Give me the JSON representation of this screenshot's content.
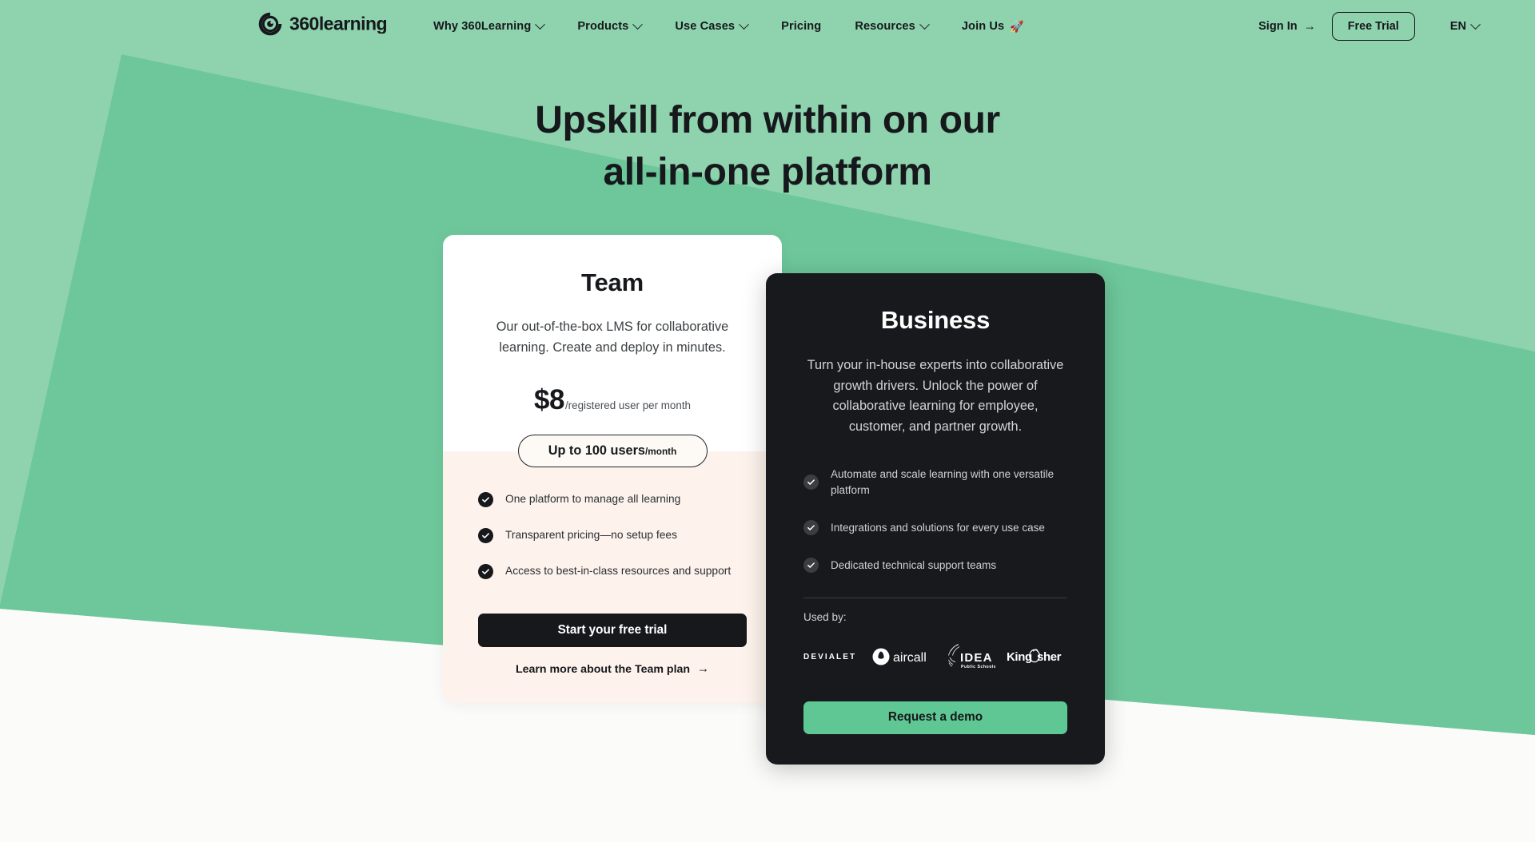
{
  "colors": {
    "bg_green_light": "#8ed3ae",
    "bg_green_dark": "#6ec79b",
    "page_white": "#fbfbfa",
    "ink": "#16181c",
    "card_cream": "#fdf3ec",
    "card_dark": "#18191d",
    "accent_green": "#5ec793"
  },
  "nav": {
    "logo_text": "360learning",
    "links": [
      {
        "label": "Why 360Learning",
        "has_caret": true
      },
      {
        "label": "Products",
        "has_caret": true
      },
      {
        "label": "Use Cases",
        "has_caret": true
      },
      {
        "label": "Pricing",
        "has_caret": false
      },
      {
        "label": "Resources",
        "has_caret": true
      },
      {
        "label": "Join Us",
        "has_caret": false,
        "emoji": "🚀"
      }
    ],
    "sign_in": "Sign In",
    "sign_in_arrow": "→",
    "free_trial": "Free Trial",
    "language": "EN"
  },
  "hero": {
    "line1": "Upskill from within on our",
    "line2": "all-in-one platform"
  },
  "team_plan": {
    "title": "Team",
    "description": "Our out-of-the-box LMS for collaborative learning. Create and deploy in minutes.",
    "price": "$8",
    "price_unit": "/registered user per month",
    "seats_badge_main": "Up to 100 users",
    "seats_badge_sub": "/month",
    "features": [
      "One platform to manage all learning",
      "Transparent pricing—no setup fees",
      "Access to best-in-class resources and support"
    ],
    "cta_primary": "Start your free trial",
    "cta_secondary": "Learn more about the Team plan",
    "cta_secondary_arrow": "→"
  },
  "business_plan": {
    "title": "Business",
    "description": "Turn your in-house experts into collaborative growth drivers. Unlock the power of collaborative learning for employee, customer, and partner growth.",
    "features": [
      "Automate and scale learning with one versatile platform",
      "Integrations and solutions for every use case",
      "Dedicated technical support teams"
    ],
    "used_by_label": "Used by:",
    "logos": [
      {
        "name": "DEVIALET"
      },
      {
        "name": "aircall"
      },
      {
        "name": "IDEA Public Schools"
      },
      {
        "name": "Kingfisher"
      }
    ],
    "cta_primary": "Request a demo"
  }
}
